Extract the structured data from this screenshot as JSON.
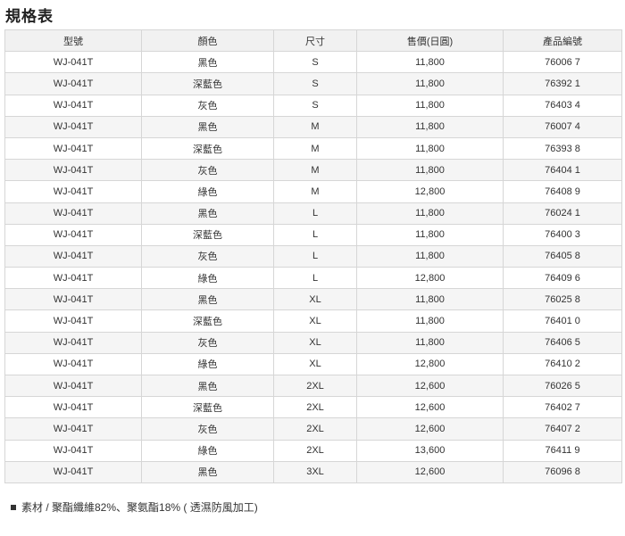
{
  "title": "規格表",
  "table": {
    "headers": [
      "型號",
      "顏色",
      "尺寸",
      "售價(日圓)",
      "產品編號"
    ],
    "rows": [
      [
        "WJ-041T",
        "黑色",
        "S",
        "11,800",
        "76006 7"
      ],
      [
        "WJ-041T",
        "深藍色",
        "S",
        "11,800",
        "76392 1"
      ],
      [
        "WJ-041T",
        "灰色",
        "S",
        "11,800",
        "76403 4"
      ],
      [
        "WJ-041T",
        "黑色",
        "M",
        "11,800",
        "76007 4"
      ],
      [
        "WJ-041T",
        "深藍色",
        "M",
        "11,800",
        "76393 8"
      ],
      [
        "WJ-041T",
        "灰色",
        "M",
        "11,800",
        "76404 1"
      ],
      [
        "WJ-041T",
        "綠色",
        "M",
        "12,800",
        "76408 9"
      ],
      [
        "WJ-041T",
        "黑色",
        "L",
        "11,800",
        "76024 1"
      ],
      [
        "WJ-041T",
        "深藍色",
        "L",
        "11,800",
        "76400 3"
      ],
      [
        "WJ-041T",
        "灰色",
        "L",
        "11,800",
        "76405 8"
      ],
      [
        "WJ-041T",
        "綠色",
        "L",
        "12,800",
        "76409 6"
      ],
      [
        "WJ-041T",
        "黑色",
        "XL",
        "11,800",
        "76025 8"
      ],
      [
        "WJ-041T",
        "深藍色",
        "XL",
        "11,800",
        "76401 0"
      ],
      [
        "WJ-041T",
        "灰色",
        "XL",
        "11,800",
        "76406 5"
      ],
      [
        "WJ-041T",
        "綠色",
        "XL",
        "12,800",
        "76410 2"
      ],
      [
        "WJ-041T",
        "黑色",
        "2XL",
        "12,600",
        "76026 5"
      ],
      [
        "WJ-041T",
        "深藍色",
        "2XL",
        "12,600",
        "76402 7"
      ],
      [
        "WJ-041T",
        "灰色",
        "2XL",
        "12,600",
        "76407 2"
      ],
      [
        "WJ-041T",
        "綠色",
        "2XL",
        "13,600",
        "76411 9"
      ],
      [
        "WJ-041T",
        "黑色",
        "3XL",
        "12,600",
        "76096 8"
      ]
    ]
  },
  "note": "素材 / 聚酯纖維82%、聚氨酯18% ( 透濕防風加工)"
}
